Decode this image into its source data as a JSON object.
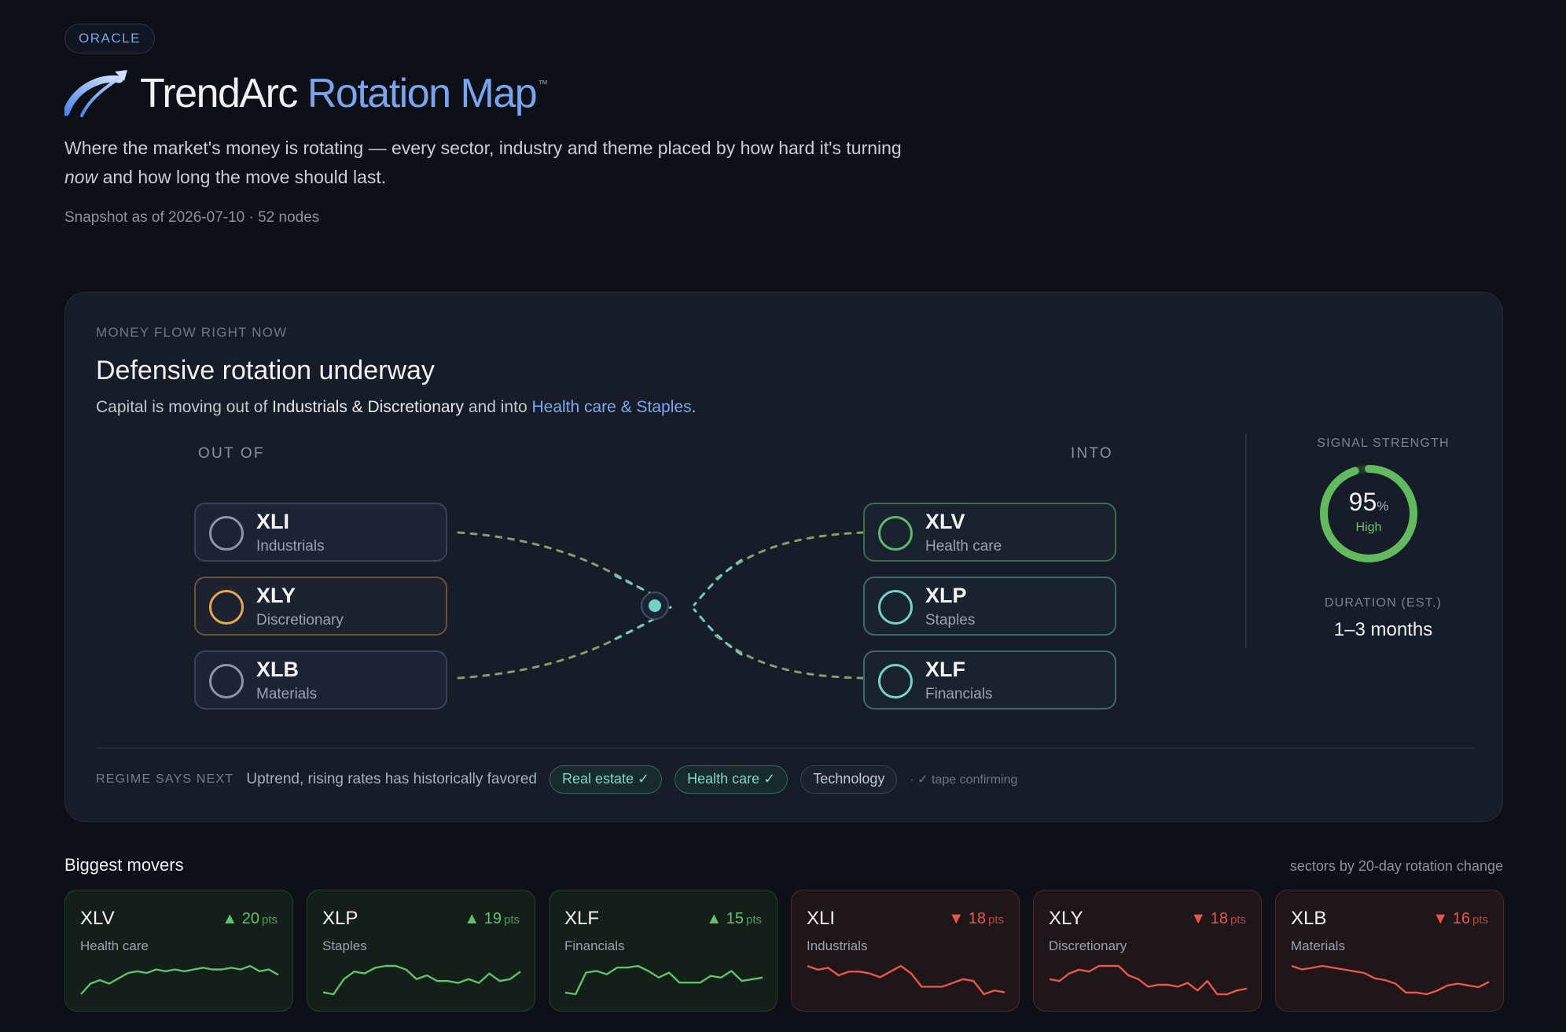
{
  "header": {
    "badge": "ORACLE",
    "title_main": "TrendArc",
    "title_accent": "Rotation Map",
    "trademark": "™",
    "desc_part1": "Where the market's money is rotating — every sector, industry and theme placed by how hard it's turning",
    "desc_emphasis": "now",
    "desc_part2": "and how long the move should last.",
    "snapshot": "Snapshot as of 2026-07-10 · 52 nodes"
  },
  "flow": {
    "eyebrow": "MONEY FLOW RIGHT NOW",
    "title": "Defensive rotation underway",
    "sub_prefix": "Capital is moving out of",
    "sub_out": "Industrials & Discretionary",
    "sub_mid": "and into",
    "sub_in": "Health care & Staples",
    "sub_end": ".",
    "out_label": "OUT OF",
    "in_label": "INTO",
    "out_nodes": [
      {
        "ticker": "XLI",
        "name": "Industrials"
      },
      {
        "ticker": "XLY",
        "name": "Discretionary"
      },
      {
        "ticker": "XLB",
        "name": "Materials"
      }
    ],
    "in_nodes": [
      {
        "ticker": "XLV",
        "name": "Health care"
      },
      {
        "ticker": "XLP",
        "name": "Staples"
      },
      {
        "ticker": "XLF",
        "name": "Financials"
      }
    ],
    "signal_label": "SIGNAL STRENGTH",
    "signal_value": "95",
    "signal_unit": "%",
    "signal_fraction": 0.95,
    "signal_level": "High",
    "duration_label": "DURATION (EST.)",
    "duration_value": "1–3 months"
  },
  "regime": {
    "label": "REGIME SAYS NEXT",
    "text": "Uptrend, rising rates has historically favored",
    "chips": [
      "Real estate ✓",
      "Health care ✓",
      "Technology"
    ],
    "note": "· ✓ tape confirming"
  },
  "movers": {
    "title": "Biggest movers",
    "note": "sectors by 20-day rotation change",
    "unit": "pts",
    "items": [
      {
        "ticker": "XLV",
        "name": "Health care",
        "change": "▲ 20",
        "dir": "up",
        "spark": [
          2,
          8,
          10,
          8,
          11,
          14,
          15,
          14,
          16,
          15,
          16,
          15,
          16,
          17,
          16,
          16,
          17,
          16,
          18,
          15,
          16,
          13
        ]
      },
      {
        "ticker": "XLP",
        "name": "Staples",
        "change": "▲ 19",
        "dir": "up",
        "spark": [
          3,
          2,
          10,
          14,
          13,
          16,
          17,
          17,
          15,
          10,
          12,
          9,
          9,
          8,
          10,
          8,
          13,
          9,
          10,
          14
        ]
      },
      {
        "ticker": "XLF",
        "name": "Financials",
        "change": "▲ 15",
        "dir": "up",
        "spark": [
          4,
          3,
          16,
          17,
          15,
          19,
          19,
          20,
          17,
          13,
          16,
          10,
          10,
          10,
          14,
          13,
          17,
          11,
          12,
          13
        ]
      },
      {
        "ticker": "XLI",
        "name": "Industrials",
        "change": "▼ 18",
        "dir": "down",
        "spark": [
          18,
          16,
          17,
          13,
          15,
          15,
          14,
          12,
          15,
          18,
          14,
          7,
          7,
          7,
          9,
          11,
          10,
          3,
          5,
          4
        ]
      },
      {
        "ticker": "XLY",
        "name": "Discretionary",
        "change": "▼ 18",
        "dir": "down",
        "spark": [
          10,
          9,
          13,
          15,
          14,
          17,
          17,
          17,
          12,
          10,
          6,
          7,
          7,
          6,
          8,
          4,
          9,
          2,
          2,
          4,
          5
        ]
      },
      {
        "ticker": "XLB",
        "name": "Materials",
        "change": "▼ 16",
        "dir": "down",
        "spark": [
          18,
          16,
          17,
          18,
          17,
          16,
          15,
          14,
          11,
          10,
          8,
          3,
          3,
          2,
          4,
          7,
          8,
          7,
          6,
          9
        ]
      }
    ]
  },
  "colors": {
    "accent": "#7aa4ee",
    "up": "#62c16b",
    "down": "#e8574a",
    "flow_in": "#6fc9bd",
    "flow_out": "#8a9b6a"
  }
}
